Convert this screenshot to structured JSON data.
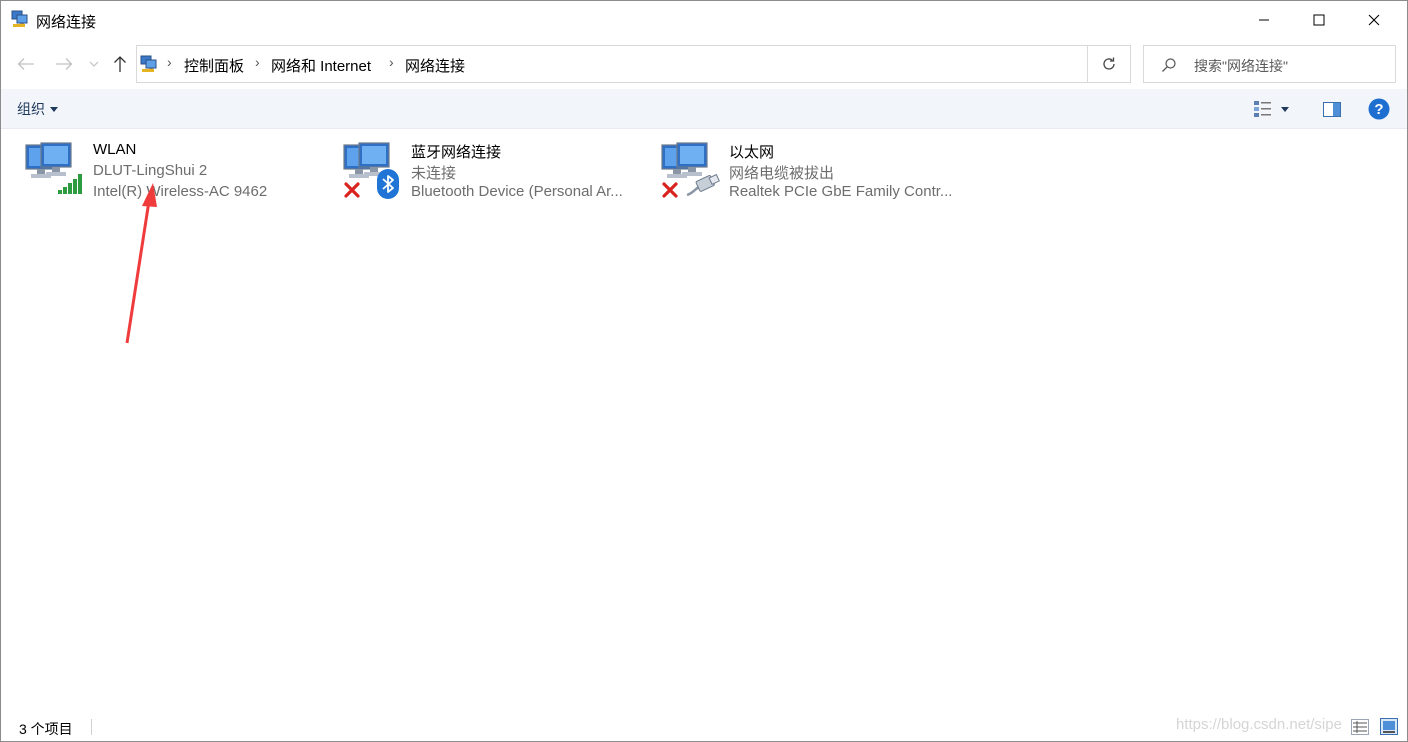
{
  "window": {
    "title": "网络连接",
    "icon": "network-connections-icon"
  },
  "titlebar": {
    "minimize_icon": "minimize-icon",
    "maximize_icon": "maximize-icon",
    "close_icon": "close-icon"
  },
  "breadcrumb": {
    "items": [
      {
        "label": "控制面板"
      },
      {
        "label": "网络和 Internet"
      },
      {
        "label": "网络连接"
      }
    ]
  },
  "search": {
    "placeholder": "搜索\"网络连接\""
  },
  "toolbar": {
    "organize_label": "组织"
  },
  "connections": [
    {
      "name": "WLAN",
      "status": "DLUT-LingShui 2",
      "device": "Intel(R) Wireless-AC 9462",
      "badge": "wifi-signal-icon"
    },
    {
      "name": "蓝牙网络连接",
      "status": "未连接",
      "device": "Bluetooth Device (Personal Ar...",
      "badge": "bluetooth-icon"
    },
    {
      "name": "以太网",
      "status": "网络电缆被拔出",
      "device": "Realtek PCIe GbE Family Contr...",
      "badge": "ethernet-cable-icon"
    }
  ],
  "statusbar": {
    "item_count": "3 个项目",
    "watermark": "https://blog.csdn.net/sipe"
  },
  "colors": {
    "command_bar_bg": "#f2f5fa",
    "organize_text": "#1e395b",
    "help_blue": "#1f6fd1",
    "error_red": "#d9231f",
    "annotation_arrow": "#ef3b3b"
  }
}
